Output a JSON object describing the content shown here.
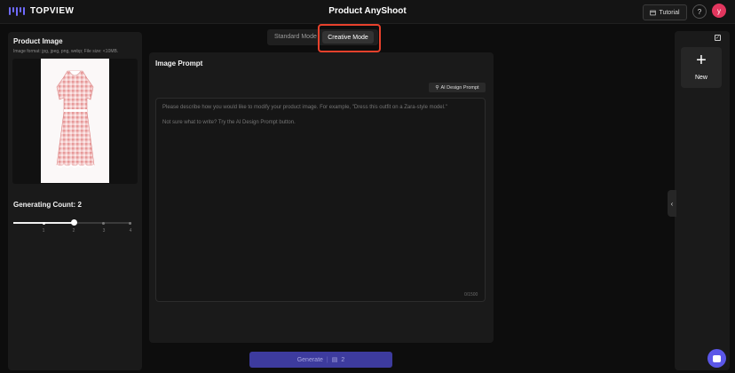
{
  "header": {
    "logo_text": "TOPVIEW",
    "title": "Product AnyShoot",
    "tutorial_label": "Tutorial",
    "help_label": "?",
    "avatar_initial": "y"
  },
  "product_image": {
    "title": "Product Image",
    "hint": "Image format: jpg, jpeg, png, webp; File size: <10MB."
  },
  "generating_count": {
    "label": "Generating Count: 2",
    "value": 2,
    "options": [
      "1",
      "2",
      "3",
      "4"
    ]
  },
  "mode_toggle": {
    "standard_label": "Standard Mode",
    "creative_label": "Creative Mode",
    "selected": "Creative Mode"
  },
  "prompt": {
    "title": "Image Prompt",
    "ai_button_label": "AI Design Prompt",
    "placeholder": "Please describe how you would like to modify your product image. For example, \"Dress this outfit on a Zara-style model.\"\n\nNot sure what to write? Try the AI Design Prompt button.",
    "char_count": "0/1500"
  },
  "generate": {
    "label": "Generate",
    "cost": "2"
  },
  "results": {
    "new_label": "New"
  },
  "icons": {
    "swap": "swap-icon",
    "tutorial": "book-icon",
    "ai": "magic-wand-icon",
    "coin": "coin-icon",
    "collapse": "chevron-left-icon",
    "chat": "chat-icon"
  },
  "colors": {
    "accent": "#5b57e8",
    "highlight": "#e8412c",
    "avatar": "#e2365e"
  }
}
